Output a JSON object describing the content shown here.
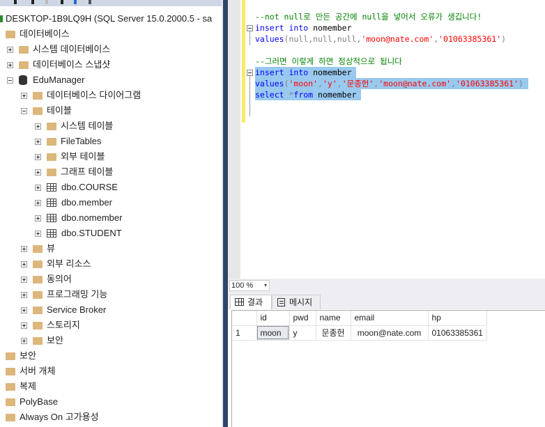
{
  "object_explorer": {
    "server": "DESKTOP-1B9LQ9H (SQL Server 15.0.2000.5 - sa",
    "tree": [
      {
        "label": "데이터베이스",
        "level": 0,
        "icon": "folder",
        "exp": "none"
      },
      {
        "label": "시스템 데이터베이스",
        "level": 1,
        "icon": "folder",
        "exp": "plus"
      },
      {
        "label": "데이터베이스 스냅샷",
        "level": 1,
        "icon": "folder",
        "exp": "plus"
      },
      {
        "label": "EduManager",
        "level": 1,
        "icon": "database",
        "exp": "minus"
      },
      {
        "label": "데이터베이스 다이어그램",
        "level": 2,
        "icon": "folder",
        "exp": "plus"
      },
      {
        "label": "테이블",
        "level": 2,
        "icon": "folder",
        "exp": "minus"
      },
      {
        "label": "시스템 테이블",
        "level": 3,
        "icon": "folder",
        "exp": "plus"
      },
      {
        "label": "FileTables",
        "level": 3,
        "icon": "folder",
        "exp": "plus"
      },
      {
        "label": "외부 테이블",
        "level": 3,
        "icon": "folder",
        "exp": "plus"
      },
      {
        "label": "그래프 테이블",
        "level": 3,
        "icon": "folder",
        "exp": "plus"
      },
      {
        "label": "dbo.COURSE",
        "level": 3,
        "icon": "table",
        "exp": "plus"
      },
      {
        "label": "dbo.member",
        "level": 3,
        "icon": "table",
        "exp": "plus"
      },
      {
        "label": "dbo.nomember",
        "level": 3,
        "icon": "table",
        "exp": "plus"
      },
      {
        "label": "dbo.STUDENT",
        "level": 3,
        "icon": "table",
        "exp": "plus"
      },
      {
        "label": "뷰",
        "level": 2,
        "icon": "folder",
        "exp": "plus"
      },
      {
        "label": "외부 리소스",
        "level": 2,
        "icon": "folder",
        "exp": "plus"
      },
      {
        "label": "동의어",
        "level": 2,
        "icon": "folder",
        "exp": "plus"
      },
      {
        "label": "프로그래밍 기능",
        "level": 2,
        "icon": "folder",
        "exp": "plus"
      },
      {
        "label": "Service Broker",
        "level": 2,
        "icon": "folder",
        "exp": "plus"
      },
      {
        "label": "스토리지",
        "level": 2,
        "icon": "folder",
        "exp": "plus"
      },
      {
        "label": "보안",
        "level": 2,
        "icon": "folder",
        "exp": "plus"
      },
      {
        "label": "보안",
        "level": 0,
        "icon": "folder",
        "exp": "none"
      },
      {
        "label": "서버 개체",
        "level": 0,
        "icon": "folder",
        "exp": "none"
      },
      {
        "label": "복제",
        "level": 0,
        "icon": "folder",
        "exp": "none"
      },
      {
        "label": "PolyBase",
        "level": 0,
        "icon": "folder",
        "exp": "none"
      },
      {
        "label": "Always On 고가용성",
        "level": 0,
        "icon": "folder",
        "exp": "none"
      }
    ]
  },
  "editor": {
    "lines": [
      {
        "fold": false,
        "sel": false,
        "tokens": [
          {
            "t": "--not null로 만든 공간에 null을 넣어서 오류가 생깁니다!",
            "c": "c"
          }
        ]
      },
      {
        "fold": true,
        "sel": false,
        "tokens": [
          {
            "t": "insert",
            "c": "k"
          },
          {
            "t": " ",
            "c": "t"
          },
          {
            "t": "into",
            "c": "k"
          },
          {
            "t": " nomember",
            "c": "t"
          }
        ]
      },
      {
        "fold": false,
        "sel": false,
        "tokens": [
          {
            "t": "values",
            "c": "k"
          },
          {
            "t": "(null,null,null,",
            "c": "g"
          },
          {
            "t": "'moon@nate.com'",
            "c": "s"
          },
          {
            "t": ",",
            "c": "g"
          },
          {
            "t": "'01063385361'",
            "c": "s"
          },
          {
            "t": ")",
            "c": "g"
          }
        ]
      },
      {
        "fold": false,
        "sel": false,
        "tokens": []
      },
      {
        "fold": false,
        "sel": false,
        "tokens": [
          {
            "t": "--그러면 이렇게 하면 정상적으로 됩니다",
            "c": "c"
          }
        ]
      },
      {
        "fold": true,
        "sel": true,
        "tokens": [
          {
            "t": "insert",
            "c": "k"
          },
          {
            "t": " ",
            "c": "t"
          },
          {
            "t": "into",
            "c": "k"
          },
          {
            "t": " nomember",
            "c": "t"
          }
        ]
      },
      {
        "fold": false,
        "sel": true,
        "tokens": [
          {
            "t": "values",
            "c": "k"
          },
          {
            "t": "(",
            "c": "g"
          },
          {
            "t": "'moon'",
            "c": "s"
          },
          {
            "t": ",",
            "c": "g"
          },
          {
            "t": "'y'",
            "c": "s"
          },
          {
            "t": ",",
            "c": "g"
          },
          {
            "t": "'문종헌'",
            "c": "s"
          },
          {
            "t": ",",
            "c": "g"
          },
          {
            "t": "'moon@nate.com'",
            "c": "s"
          },
          {
            "t": ",",
            "c": "g"
          },
          {
            "t": "'01063385361'",
            "c": "s"
          },
          {
            "t": ")",
            "c": "g"
          }
        ]
      },
      {
        "fold": false,
        "sel": true,
        "tokens": [
          {
            "t": "select",
            "c": "k"
          },
          {
            "t": " *",
            "c": "g"
          },
          {
            "t": "from",
            "c": "k"
          },
          {
            "t": " nomember",
            "c": "t"
          }
        ]
      }
    ]
  },
  "zoom": {
    "value": "100 %",
    "arrow": "▾"
  },
  "results": {
    "tabs": [
      {
        "label": "결과",
        "active": true
      },
      {
        "label": "메시지",
        "active": false
      }
    ],
    "columns": [
      "",
      "id",
      "pwd",
      "name",
      "email",
      "hp"
    ],
    "rows": [
      [
        "1",
        "moon",
        "y",
        "문종헌",
        "moon@nate.com",
        "01063385361"
      ]
    ]
  }
}
